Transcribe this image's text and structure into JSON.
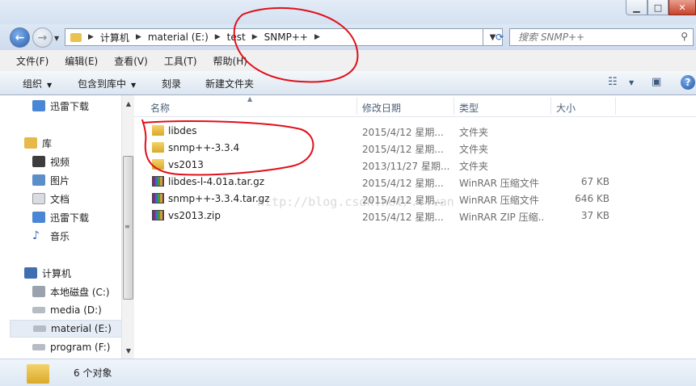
{
  "address": {
    "crumbs": [
      "计算机",
      "material (E:)",
      "test",
      "SNMP++"
    ]
  },
  "search": {
    "placeholder": "搜索 SNMP++"
  },
  "menu": [
    "文件(F)",
    "编辑(E)",
    "查看(V)",
    "工具(T)",
    "帮助(H)"
  ],
  "toolbar": {
    "organize": "组织",
    "include_in_library": "包含到库中",
    "burn": "刻录",
    "new_folder": "新建文件夹"
  },
  "nav": {
    "items": [
      {
        "label": "迅雷下载",
        "icon": "download-icon"
      },
      {
        "label": "库",
        "icon": "library-icon"
      },
      {
        "label": "视频",
        "icon": "video-icon"
      },
      {
        "label": "图片",
        "icon": "picture-icon"
      },
      {
        "label": "文档",
        "icon": "document-icon"
      },
      {
        "label": "迅雷下载",
        "icon": "download-icon"
      },
      {
        "label": "音乐",
        "icon": "music-icon"
      },
      {
        "label": "计算机",
        "icon": "computer-icon"
      },
      {
        "label": "本地磁盘 (C:)",
        "icon": "drive-icon"
      },
      {
        "label": "media (D:)",
        "icon": "drive-icon"
      },
      {
        "label": "material (E:)",
        "icon": "drive-icon"
      },
      {
        "label": "program (F:)",
        "icon": "drive-icon"
      }
    ]
  },
  "columns": {
    "name": "名称",
    "date": "修改日期",
    "type": "类型",
    "size": "大小"
  },
  "files": [
    {
      "name": "libdes",
      "date": "2015/4/12 星期...",
      "type": "文件夹",
      "size": "",
      "icon": "folder-icon"
    },
    {
      "name": "snmp++-3.3.4",
      "date": "2015/4/12 星期...",
      "type": "文件夹",
      "size": "",
      "icon": "folder-icon"
    },
    {
      "name": "vs2013",
      "date": "2013/11/27 星期...",
      "type": "文件夹",
      "size": "",
      "icon": "folder-icon"
    },
    {
      "name": "libdes-l-4.01a.tar.gz",
      "date": "2015/4/12 星期...",
      "type": "WinRAR 压缩文件",
      "size": "67 KB",
      "icon": "rar-icon"
    },
    {
      "name": "snmp++-3.3.4.tar.gz",
      "date": "2015/4/12 星期...",
      "type": "WinRAR 压缩文件",
      "size": "646 KB",
      "icon": "rar-icon"
    },
    {
      "name": "vs2013.zip",
      "date": "2015/4/12 星期...",
      "type": "WinRAR ZIP 压缩...",
      "size": "37 KB",
      "icon": "rar-icon"
    }
  ],
  "status": {
    "count": "6 个对象"
  },
  "watermark": "http://blog.csdn.net/...van",
  "colors": {
    "annotation": "#e0101a",
    "accent": "#2a63b5"
  }
}
